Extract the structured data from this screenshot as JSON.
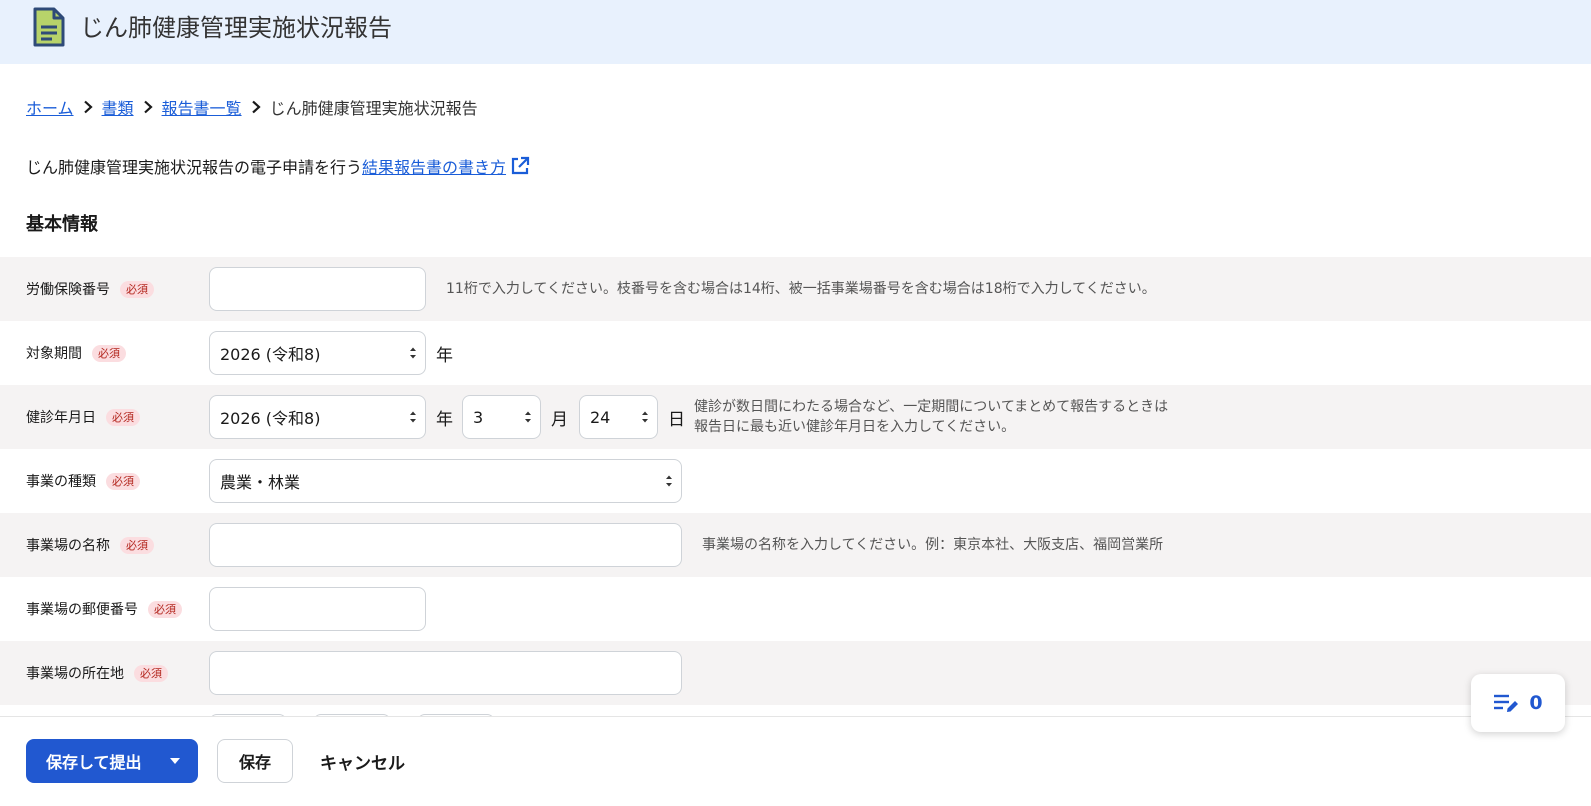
{
  "header": {
    "title": "じん肺健康管理実施状況報告",
    "icon": "document-icon"
  },
  "breadcrumb": {
    "home": "ホーム",
    "documents": "書類",
    "report_list": "報告書一覧",
    "current": "じん肺健康管理実施状況報告"
  },
  "description": {
    "text": "じん肺健康管理実施状況報告の電子申請を行う",
    "guide_link": "結果報告書の書き方"
  },
  "section_title": "基本情報",
  "required_label": "必須",
  "fields": {
    "labor_insurance_number": {
      "label": "労働保険番号",
      "value": "",
      "hint": "11桁で入力してください。枝番号を含む場合は14桁、被一括事業場番号を含む場合は18桁で入力してください。"
    },
    "target_period": {
      "label": "対象期間",
      "year_value": "2026 (令和8)",
      "year_unit": "年"
    },
    "exam_date": {
      "label": "健診年月日",
      "year_value": "2026 (令和8)",
      "year_unit": "年",
      "month_value": "3",
      "month_unit": "月",
      "day_value": "24",
      "day_unit": "日",
      "hint_line1": "健診が数日間にわたる場合など、一定期間についてまとめて報告するときは",
      "hint_line2": "報告日に最も近い健診年月日を入力してください。"
    },
    "business_type": {
      "label": "事業の種類",
      "value": "農業・林業"
    },
    "workplace_name": {
      "label": "事業場の名称",
      "value": "",
      "hint": "事業場の名称を入力してください。例：東京本社、大阪支店、福岡営業所"
    },
    "workplace_postal_code": {
      "label": "事業場の郵便番号",
      "value": ""
    },
    "workplace_address": {
      "label": "事業場の所在地",
      "value": ""
    }
  },
  "footer": {
    "submit_label": "保存して提出",
    "save_label": "保存",
    "cancel_label": "キャンセル"
  },
  "fab": {
    "count": "0",
    "icon": "edit-list-icon"
  },
  "colors": {
    "primary": "#2158d0",
    "header_bg": "#e8f1fd",
    "link": "#1a5dd8",
    "row_shade": "#f5f3f3",
    "required_bg": "#fbdde0",
    "required_text": "#b3261e"
  }
}
